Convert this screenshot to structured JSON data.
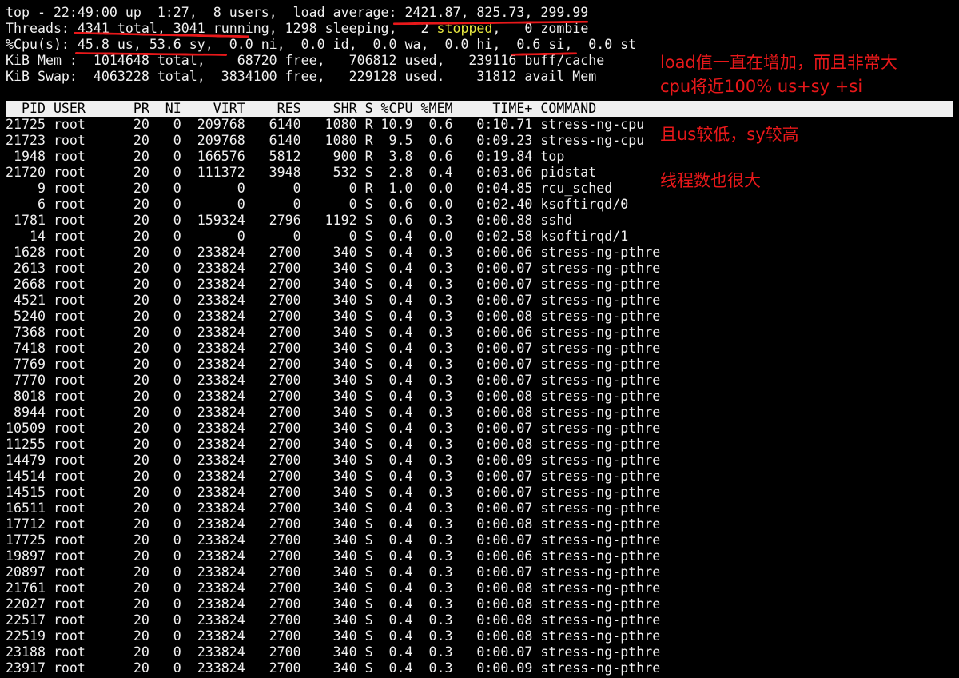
{
  "summary": {
    "uptime_line": "top - 22:49:00 up  1:27,  8 users,  load average: 2421.87, 825.73, 299.99",
    "threads_pre": "Threads: 4341 total, 3041 running, 1298 sleeping,   2 ",
    "threads_stopped": "stopped",
    "threads_post": ",   0 zombie",
    "cpu_line": "%Cpu(s): 45.8 us, 53.6 sy,  0.0 ni,  0.0 id,  0.0 wa,  0.0 hi,  0.6 si,  0.0 st",
    "mem_line": "KiB Mem :  1014648 total,    68720 free,   706812 used,   239116 buff/cache",
    "swap_line": "KiB Swap:  4063228 total,  3834100 free,   229128 used.    31812 avail Mem"
  },
  "table": {
    "header": "  PID USER      PR  NI    VIRT    RES    SHR S %CPU %MEM     TIME+ COMMAND",
    "rows": [
      {
        "pid": "21725",
        "user": "root",
        "pr": "20",
        "ni": "0",
        "virt": "209768",
        "res": "6140",
        "shr": "1080",
        "s": "R",
        "cpu": "10.9",
        "mem": "0.6",
        "time": "0:10.71",
        "cmd": "stress-ng-cpu"
      },
      {
        "pid": "21723",
        "user": "root",
        "pr": "20",
        "ni": "0",
        "virt": "209768",
        "res": "6140",
        "shr": "1080",
        "s": "R",
        "cpu": "9.5",
        "mem": "0.6",
        "time": "0:09.23",
        "cmd": "stress-ng-cpu"
      },
      {
        "pid": "1948",
        "user": "root",
        "pr": "20",
        "ni": "0",
        "virt": "166576",
        "res": "5812",
        "shr": "900",
        "s": "R",
        "cpu": "3.8",
        "mem": "0.6",
        "time": "0:19.84",
        "cmd": "top"
      },
      {
        "pid": "21720",
        "user": "root",
        "pr": "20",
        "ni": "0",
        "virt": "111372",
        "res": "3948",
        "shr": "532",
        "s": "S",
        "cpu": "2.8",
        "mem": "0.4",
        "time": "0:03.06",
        "cmd": "pidstat"
      },
      {
        "pid": "9",
        "user": "root",
        "pr": "20",
        "ni": "0",
        "virt": "0",
        "res": "0",
        "shr": "0",
        "s": "R",
        "cpu": "1.0",
        "mem": "0.0",
        "time": "0:04.85",
        "cmd": "rcu_sched"
      },
      {
        "pid": "6",
        "user": "root",
        "pr": "20",
        "ni": "0",
        "virt": "0",
        "res": "0",
        "shr": "0",
        "s": "S",
        "cpu": "0.6",
        "mem": "0.0",
        "time": "0:02.40",
        "cmd": "ksoftirqd/0"
      },
      {
        "pid": "1781",
        "user": "root",
        "pr": "20",
        "ni": "0",
        "virt": "159324",
        "res": "2796",
        "shr": "1192",
        "s": "S",
        "cpu": "0.6",
        "mem": "0.3",
        "time": "0:00.88",
        "cmd": "sshd"
      },
      {
        "pid": "14",
        "user": "root",
        "pr": "20",
        "ni": "0",
        "virt": "0",
        "res": "0",
        "shr": "0",
        "s": "S",
        "cpu": "0.4",
        "mem": "0.0",
        "time": "0:02.58",
        "cmd": "ksoftirqd/1"
      },
      {
        "pid": "1628",
        "user": "root",
        "pr": "20",
        "ni": "0",
        "virt": "233824",
        "res": "2700",
        "shr": "340",
        "s": "S",
        "cpu": "0.4",
        "mem": "0.3",
        "time": "0:00.06",
        "cmd": "stress-ng-pthre"
      },
      {
        "pid": "2613",
        "user": "root",
        "pr": "20",
        "ni": "0",
        "virt": "233824",
        "res": "2700",
        "shr": "340",
        "s": "S",
        "cpu": "0.4",
        "mem": "0.3",
        "time": "0:00.07",
        "cmd": "stress-ng-pthre"
      },
      {
        "pid": "2668",
        "user": "root",
        "pr": "20",
        "ni": "0",
        "virt": "233824",
        "res": "2700",
        "shr": "340",
        "s": "S",
        "cpu": "0.4",
        "mem": "0.3",
        "time": "0:00.07",
        "cmd": "stress-ng-pthre"
      },
      {
        "pid": "4521",
        "user": "root",
        "pr": "20",
        "ni": "0",
        "virt": "233824",
        "res": "2700",
        "shr": "340",
        "s": "S",
        "cpu": "0.4",
        "mem": "0.3",
        "time": "0:00.07",
        "cmd": "stress-ng-pthre"
      },
      {
        "pid": "5240",
        "user": "root",
        "pr": "20",
        "ni": "0",
        "virt": "233824",
        "res": "2700",
        "shr": "340",
        "s": "S",
        "cpu": "0.4",
        "mem": "0.3",
        "time": "0:00.08",
        "cmd": "stress-ng-pthre"
      },
      {
        "pid": "7368",
        "user": "root",
        "pr": "20",
        "ni": "0",
        "virt": "233824",
        "res": "2700",
        "shr": "340",
        "s": "S",
        "cpu": "0.4",
        "mem": "0.3",
        "time": "0:00.06",
        "cmd": "stress-ng-pthre"
      },
      {
        "pid": "7418",
        "user": "root",
        "pr": "20",
        "ni": "0",
        "virt": "233824",
        "res": "2700",
        "shr": "340",
        "s": "S",
        "cpu": "0.4",
        "mem": "0.3",
        "time": "0:00.07",
        "cmd": "stress-ng-pthre"
      },
      {
        "pid": "7769",
        "user": "root",
        "pr": "20",
        "ni": "0",
        "virt": "233824",
        "res": "2700",
        "shr": "340",
        "s": "S",
        "cpu": "0.4",
        "mem": "0.3",
        "time": "0:00.07",
        "cmd": "stress-ng-pthre"
      },
      {
        "pid": "7770",
        "user": "root",
        "pr": "20",
        "ni": "0",
        "virt": "233824",
        "res": "2700",
        "shr": "340",
        "s": "S",
        "cpu": "0.4",
        "mem": "0.3",
        "time": "0:00.07",
        "cmd": "stress-ng-pthre"
      },
      {
        "pid": "8018",
        "user": "root",
        "pr": "20",
        "ni": "0",
        "virt": "233824",
        "res": "2700",
        "shr": "340",
        "s": "S",
        "cpu": "0.4",
        "mem": "0.3",
        "time": "0:00.08",
        "cmd": "stress-ng-pthre"
      },
      {
        "pid": "8944",
        "user": "root",
        "pr": "20",
        "ni": "0",
        "virt": "233824",
        "res": "2700",
        "shr": "340",
        "s": "S",
        "cpu": "0.4",
        "mem": "0.3",
        "time": "0:00.08",
        "cmd": "stress-ng-pthre"
      },
      {
        "pid": "10509",
        "user": "root",
        "pr": "20",
        "ni": "0",
        "virt": "233824",
        "res": "2700",
        "shr": "340",
        "s": "S",
        "cpu": "0.4",
        "mem": "0.3",
        "time": "0:00.07",
        "cmd": "stress-ng-pthre"
      },
      {
        "pid": "11255",
        "user": "root",
        "pr": "20",
        "ni": "0",
        "virt": "233824",
        "res": "2700",
        "shr": "340",
        "s": "S",
        "cpu": "0.4",
        "mem": "0.3",
        "time": "0:00.08",
        "cmd": "stress-ng-pthre"
      },
      {
        "pid": "14479",
        "user": "root",
        "pr": "20",
        "ni": "0",
        "virt": "233824",
        "res": "2700",
        "shr": "340",
        "s": "S",
        "cpu": "0.4",
        "mem": "0.3",
        "time": "0:00.09",
        "cmd": "stress-ng-pthre"
      },
      {
        "pid": "14514",
        "user": "root",
        "pr": "20",
        "ni": "0",
        "virt": "233824",
        "res": "2700",
        "shr": "340",
        "s": "S",
        "cpu": "0.4",
        "mem": "0.3",
        "time": "0:00.07",
        "cmd": "stress-ng-pthre"
      },
      {
        "pid": "14515",
        "user": "root",
        "pr": "20",
        "ni": "0",
        "virt": "233824",
        "res": "2700",
        "shr": "340",
        "s": "S",
        "cpu": "0.4",
        "mem": "0.3",
        "time": "0:00.07",
        "cmd": "stress-ng-pthre"
      },
      {
        "pid": "16511",
        "user": "root",
        "pr": "20",
        "ni": "0",
        "virt": "233824",
        "res": "2700",
        "shr": "340",
        "s": "S",
        "cpu": "0.4",
        "mem": "0.3",
        "time": "0:00.07",
        "cmd": "stress-ng-pthre"
      },
      {
        "pid": "17712",
        "user": "root",
        "pr": "20",
        "ni": "0",
        "virt": "233824",
        "res": "2700",
        "shr": "340",
        "s": "S",
        "cpu": "0.4",
        "mem": "0.3",
        "time": "0:00.08",
        "cmd": "stress-ng-pthre"
      },
      {
        "pid": "17725",
        "user": "root",
        "pr": "20",
        "ni": "0",
        "virt": "233824",
        "res": "2700",
        "shr": "340",
        "s": "S",
        "cpu": "0.4",
        "mem": "0.3",
        "time": "0:00.07",
        "cmd": "stress-ng-pthre"
      },
      {
        "pid": "19897",
        "user": "root",
        "pr": "20",
        "ni": "0",
        "virt": "233824",
        "res": "2700",
        "shr": "340",
        "s": "S",
        "cpu": "0.4",
        "mem": "0.3",
        "time": "0:00.06",
        "cmd": "stress-ng-pthre"
      },
      {
        "pid": "20897",
        "user": "root",
        "pr": "20",
        "ni": "0",
        "virt": "233824",
        "res": "2700",
        "shr": "340",
        "s": "S",
        "cpu": "0.4",
        "mem": "0.3",
        "time": "0:00.07",
        "cmd": "stress-ng-pthre"
      },
      {
        "pid": "21761",
        "user": "root",
        "pr": "20",
        "ni": "0",
        "virt": "233824",
        "res": "2700",
        "shr": "340",
        "s": "S",
        "cpu": "0.4",
        "mem": "0.3",
        "time": "0:00.08",
        "cmd": "stress-ng-pthre"
      },
      {
        "pid": "22027",
        "user": "root",
        "pr": "20",
        "ni": "0",
        "virt": "233824",
        "res": "2700",
        "shr": "340",
        "s": "S",
        "cpu": "0.4",
        "mem": "0.3",
        "time": "0:00.08",
        "cmd": "stress-ng-pthre"
      },
      {
        "pid": "22517",
        "user": "root",
        "pr": "20",
        "ni": "0",
        "virt": "233824",
        "res": "2700",
        "shr": "340",
        "s": "S",
        "cpu": "0.4",
        "mem": "0.3",
        "time": "0:00.08",
        "cmd": "stress-ng-pthre"
      },
      {
        "pid": "22519",
        "user": "root",
        "pr": "20",
        "ni": "0",
        "virt": "233824",
        "res": "2700",
        "shr": "340",
        "s": "S",
        "cpu": "0.4",
        "mem": "0.3",
        "time": "0:00.08",
        "cmd": "stress-ng-pthre"
      },
      {
        "pid": "23188",
        "user": "root",
        "pr": "20",
        "ni": "0",
        "virt": "233824",
        "res": "2700",
        "shr": "340",
        "s": "S",
        "cpu": "0.4",
        "mem": "0.3",
        "time": "0:00.07",
        "cmd": "stress-ng-pthre"
      },
      {
        "pid": "23917",
        "user": "root",
        "pr": "20",
        "ni": "0",
        "virt": "233824",
        "res": "2700",
        "shr": "340",
        "s": "S",
        "cpu": "0.4",
        "mem": "0.3",
        "time": "0:00.09",
        "cmd": "stress-ng-pthre"
      }
    ]
  },
  "annotations": {
    "load": "load值一直在增加，而且非常大",
    "cpu": "cpu将近100% us+sy +si",
    "us_sy": "且us较低，sy较高",
    "threads": "线程数也很大"
  },
  "colors": {
    "annotation": "#e8181a",
    "stopped": "#e6e640",
    "header_bg": "#f0f0f0"
  }
}
